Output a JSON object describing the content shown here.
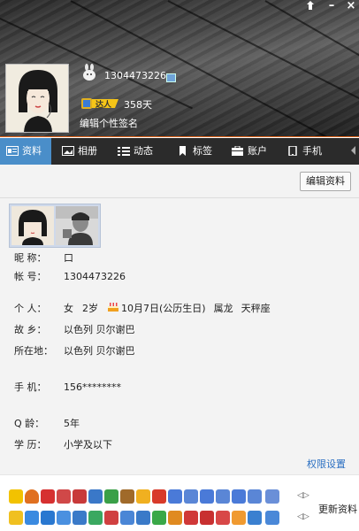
{
  "header": {
    "qq_number": "1304473226",
    "level_label": "达人",
    "days": "358天",
    "signature": "编辑个性签名",
    "window_buttons": {
      "menu": "⏷",
      "minimize": "–",
      "close": "×"
    }
  },
  "nav": {
    "tabs": [
      {
        "label": "资料",
        "icon": "profile-card-icon",
        "active": true
      },
      {
        "label": "相册",
        "icon": "photo-album-icon",
        "active": false
      },
      {
        "label": "动态",
        "icon": "feed-list-icon",
        "active": false
      },
      {
        "label": "标签",
        "icon": "bookmark-tag-icon",
        "active": false
      },
      {
        "label": "账户",
        "icon": "wallet-icon",
        "active": false
      },
      {
        "label": "手机",
        "icon": "mobile-phone-icon",
        "active": false
      }
    ]
  },
  "profile": {
    "edit_button": "编辑资料",
    "fields": {
      "nickname": {
        "label": "昵    称：",
        "value": "口"
      },
      "account": {
        "label": "帐    号：",
        "value": "1304473226"
      },
      "personal": {
        "label": "个    人：",
        "gender": "女",
        "age": "2岁",
        "birthday": "10月7日(公历生日)",
        "zodiac": "属龙",
        "constellation": "天秤座"
      },
      "hometown": {
        "label": "故    乡：",
        "value": "以色列 贝尔谢巴"
      },
      "location": {
        "label": "所在地：",
        "value": "以色列 贝尔谢巴"
      },
      "phone": {
        "label": "手    机：",
        "value": "156********"
      },
      "q_age": {
        "label": "Q    龄：",
        "value": "5年"
      },
      "education": {
        "label": "学    历：",
        "value": "小学及以下"
      }
    },
    "permission_link": "权限设置"
  },
  "bottom": {
    "tip_text": "更新资料",
    "row1_icons": [
      "yellow-gem-icon",
      "person-icon",
      "red-person-icon",
      "red-folder-icon",
      "red-folder-icon",
      "blue-folder-icon",
      "green-folder-icon",
      "brown-folder-icon",
      "star-icon",
      "red-box-icon",
      "blue-gem-icon",
      "blue-gem-icon",
      "blue-gem-icon",
      "blue-gem-icon",
      "blue-gem-icon",
      "blue-gem-icon"
    ],
    "row2_icons": [
      "yellow-star-icon",
      "blue-box-icon",
      "blue-box-icon",
      "blue-gem-icon",
      "blue-cup-icon",
      "green-gem-icon",
      "red-box-icon",
      "blue-gem-icon",
      "blue-gem-icon",
      "green-box-icon",
      "orange-person-icon",
      "red-person-icon",
      "red-gem-icon",
      "red-person-icon",
      "orange-heart-icon",
      "blue-box-icon",
      "blue-box-icon"
    ]
  }
}
